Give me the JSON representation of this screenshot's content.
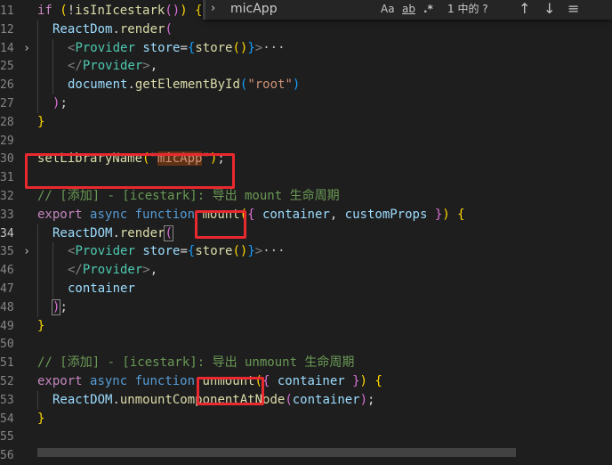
{
  "find_widget": {
    "toggle_icon": "chevron-right-icon",
    "query": "micApp",
    "options": [
      "Aa",
      "ab",
      ".*"
    ],
    "result": "1 中的 ?",
    "prev_icon": "arrow-up-icon",
    "next_icon": "arrow-down-icon",
    "menu_icon": "hamburger-icon"
  },
  "lines": [
    {
      "n": "11",
      "fold": "",
      "indent": 0,
      "toks": [
        [
          "if",
          "ctrl"
        ],
        [
          " ",
          "p"
        ],
        [
          "(",
          "b1"
        ],
        [
          "!",
          "p"
        ],
        [
          "isInIcestark",
          "fn"
        ],
        [
          "()",
          "b2"
        ],
        [
          ")",
          "b1"
        ],
        [
          " ",
          "p"
        ],
        [
          "{",
          "b1"
        ]
      ]
    },
    {
      "n": "12",
      "fold": "",
      "indent": 1,
      "toks": [
        [
          "ReactDom",
          "var"
        ],
        [
          ".",
          "p"
        ],
        [
          "render",
          "fn"
        ],
        [
          "(",
          "b2"
        ]
      ]
    },
    {
      "n": "14",
      "fold": ">",
      "indent": 2,
      "toks": [
        [
          "<",
          "tagp"
        ],
        [
          "Provider",
          "tag"
        ],
        [
          " ",
          "p"
        ],
        [
          "store",
          "var"
        ],
        [
          "=",
          "p"
        ],
        [
          "{",
          "b3"
        ],
        [
          "store",
          "fn"
        ],
        [
          "()",
          "b1"
        ],
        [
          "}",
          "b3"
        ],
        [
          ">",
          "tagp"
        ],
        [
          "···",
          "ell"
        ]
      ]
    },
    {
      "n": "25",
      "fold": "",
      "indent": 2,
      "toks": [
        [
          "</",
          "tagp"
        ],
        [
          "Provider",
          "tag"
        ],
        [
          ">",
          "tagp"
        ],
        [
          ",",
          "p"
        ]
      ]
    },
    {
      "n": "26",
      "fold": "",
      "indent": 2,
      "toks": [
        [
          "document",
          "var"
        ],
        [
          ".",
          "p"
        ],
        [
          "getElementById",
          "fn"
        ],
        [
          "(",
          "b3"
        ],
        [
          "\"root\"",
          "str"
        ],
        [
          ")",
          "b3"
        ]
      ]
    },
    {
      "n": "27",
      "fold": "",
      "indent": 1,
      "toks": [
        [
          ")",
          "b2"
        ],
        [
          ";",
          "p"
        ]
      ]
    },
    {
      "n": "28",
      "fold": "",
      "indent": 0,
      "toks": [
        [
          "}",
          "b1"
        ]
      ]
    },
    {
      "n": "29",
      "fold": "",
      "indent": 0,
      "toks": []
    },
    {
      "n": "30",
      "fold": "",
      "indent": 0,
      "toks": [
        [
          "setLibraryName",
          "fn"
        ],
        [
          "(",
          "b1"
        ],
        [
          "\"",
          "str"
        ],
        [
          "micApp",
          "strhl"
        ],
        [
          "\"",
          "str"
        ],
        [
          ")",
          "b1"
        ],
        [
          ";",
          "p"
        ]
      ]
    },
    {
      "n": "31",
      "fold": "",
      "indent": 0,
      "toks": []
    },
    {
      "n": "32",
      "fold": "",
      "indent": 0,
      "toks": [
        [
          "// [添加] - [icestark]: 导出 mount 生命周期",
          "cmt"
        ]
      ]
    },
    {
      "n": "33",
      "fold": "",
      "indent": 0,
      "toks": [
        [
          "export",
          "ctrl"
        ],
        [
          " ",
          "p"
        ],
        [
          "async",
          "kw"
        ],
        [
          " ",
          "p"
        ],
        [
          "function",
          "kw"
        ],
        [
          " ",
          "p"
        ],
        [
          "mount",
          "fn"
        ],
        [
          "(",
          "b1"
        ],
        [
          "{",
          "b2"
        ],
        [
          " ",
          "p"
        ],
        [
          "container",
          "var"
        ],
        [
          ", ",
          "p"
        ],
        [
          "customProps",
          "var"
        ],
        [
          " ",
          "p"
        ],
        [
          "}",
          "b2"
        ],
        [
          ")",
          "b1"
        ],
        [
          " ",
          "p"
        ],
        [
          "{",
          "b1"
        ]
      ]
    },
    {
      "n": "34",
      "fold": "",
      "indent": 1,
      "active": true,
      "toks": [
        [
          "ReactDOM",
          "var"
        ],
        [
          ".",
          "p"
        ],
        [
          "render",
          "fn"
        ],
        [
          "(",
          "bm"
        ]
      ]
    },
    {
      "n": "35",
      "fold": ">",
      "indent": 2,
      "toks": [
        [
          "<",
          "tagp"
        ],
        [
          "Provider",
          "tag"
        ],
        [
          " ",
          "p"
        ],
        [
          "store",
          "var"
        ],
        [
          "=",
          "p"
        ],
        [
          "{",
          "b3"
        ],
        [
          "store",
          "fn"
        ],
        [
          "()",
          "b1"
        ],
        [
          "}",
          "b3"
        ],
        [
          ">",
          "tagp"
        ],
        [
          "···",
          "ell"
        ]
      ]
    },
    {
      "n": "46",
      "fold": "",
      "indent": 2,
      "toks": [
        [
          "</",
          "tagp"
        ],
        [
          "Provider",
          "tag"
        ],
        [
          ">",
          "tagp"
        ],
        [
          ",",
          "p"
        ]
      ]
    },
    {
      "n": "47",
      "fold": "",
      "indent": 2,
      "toks": [
        [
          "container",
          "var"
        ]
      ]
    },
    {
      "n": "48",
      "fold": "",
      "indent": 1,
      "toks": [
        [
          ")",
          "bm"
        ],
        [
          ";",
          "p"
        ]
      ]
    },
    {
      "n": "49",
      "fold": "",
      "indent": 0,
      "toks": [
        [
          "}",
          "b1"
        ]
      ]
    },
    {
      "n": "50",
      "fold": "",
      "indent": 0,
      "toks": []
    },
    {
      "n": "51",
      "fold": "",
      "indent": 0,
      "toks": [
        [
          "// [添加] - [icestark]: 导出 unmount 生命周期",
          "cmt"
        ]
      ]
    },
    {
      "n": "52",
      "fold": "",
      "indent": 0,
      "toks": [
        [
          "export",
          "ctrl"
        ],
        [
          " ",
          "p"
        ],
        [
          "async",
          "kw"
        ],
        [
          " ",
          "p"
        ],
        [
          "function",
          "kw"
        ],
        [
          " ",
          "p"
        ],
        [
          "unmount",
          "fn"
        ],
        [
          "(",
          "b1"
        ],
        [
          "{",
          "b2"
        ],
        [
          " ",
          "p"
        ],
        [
          "container",
          "var"
        ],
        [
          " ",
          "p"
        ],
        [
          "}",
          "b2"
        ],
        [
          ")",
          "b1"
        ],
        [
          " ",
          "p"
        ],
        [
          "{",
          "b1"
        ]
      ]
    },
    {
      "n": "53",
      "fold": "",
      "indent": 1,
      "toks": [
        [
          "ReactDOM",
          "var"
        ],
        [
          ".",
          "p"
        ],
        [
          "unmountComponentAtNode",
          "fn"
        ],
        [
          "(",
          "b2"
        ],
        [
          "container",
          "var"
        ],
        [
          ")",
          "b2"
        ],
        [
          ";",
          "p"
        ]
      ]
    },
    {
      "n": "54",
      "fold": "",
      "indent": 0,
      "toks": [
        [
          "}",
          "b1"
        ]
      ]
    },
    {
      "n": "55",
      "fold": "",
      "indent": 0,
      "toks": []
    },
    {
      "n": "56",
      "fold": "",
      "indent": 0,
      "toks": []
    }
  ],
  "colors": {
    "highlight_box": "#e8292f",
    "background": "#1e1e1e"
  }
}
